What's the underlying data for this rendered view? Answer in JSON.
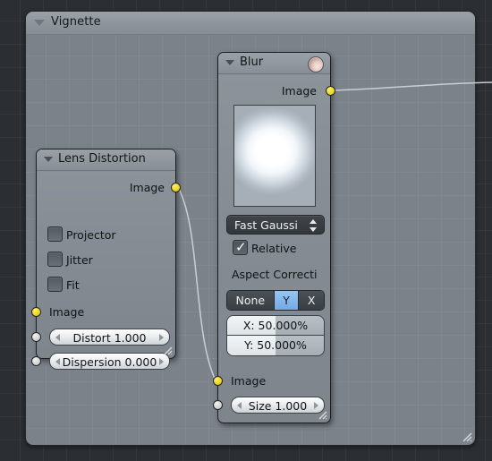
{
  "editor": {
    "background_color": "#2b2f33",
    "grid_color": "#3a3f44"
  },
  "frame": {
    "title": "Vignette",
    "collapse_icon": "triangle-down-icon",
    "resize_grip": "resize-grip-icon"
  },
  "nodes": [
    {
      "id": "blur",
      "title": "Blur",
      "header_icon": "preview-image-icon",
      "collapse_icon": "triangle-down-icon",
      "outputs": [
        {
          "name": "Image",
          "socket": "image-socket",
          "color": "#e8d11d"
        }
      ],
      "preview": {
        "name": "blur-preview-thumbnail"
      },
      "filter_type": {
        "value": "Fast Gaussi",
        "icon": "up-down-arrows-icon"
      },
      "relative": {
        "label": "Relative",
        "checked": true
      },
      "aspect_correction": {
        "label": "Aspect Correcti",
        "options": [
          "None",
          "Y",
          "X"
        ],
        "selected": "Y"
      },
      "size_xy": [
        {
          "label": "X: 50.000%",
          "percent": 50
        },
        {
          "label": "Y: 50.000%",
          "percent": 50
        }
      ],
      "inputs": [
        {
          "name": "Image",
          "socket": "image-socket",
          "color": "#e8d11d"
        },
        {
          "name": "Size 1.000",
          "socket": "value-socket",
          "color": "#d4d4d4"
        }
      ],
      "resize_grip": "resize-grip-icon"
    },
    {
      "id": "lens_distortion",
      "title": "Lens Distortion",
      "collapse_icon": "triangle-down-icon",
      "outputs": [
        {
          "name": "Image",
          "socket": "image-socket",
          "color": "#e8d11d"
        }
      ],
      "checkboxes": [
        {
          "label": "Projector",
          "checked": false
        },
        {
          "label": "Jitter",
          "checked": false
        },
        {
          "label": "Fit",
          "checked": false
        }
      ],
      "inputs": [
        {
          "name": "Image",
          "socket": "image-socket",
          "color": "#e8d11d"
        },
        {
          "name": "Distort 1.000",
          "socket": "value-socket",
          "color": "#d4d4d4"
        },
        {
          "name": "Dispersion 0.000",
          "socket": "value-socket",
          "color": "#d4d4d4"
        }
      ],
      "resize_grip": "resize-grip-icon"
    }
  ],
  "links": [
    {
      "from": "lens_distortion.Image",
      "to": "blur.Image",
      "color": "#d3d6d8"
    },
    {
      "from": "blur.Image",
      "to": "offscreen",
      "color": "#d3d6d8"
    }
  ]
}
